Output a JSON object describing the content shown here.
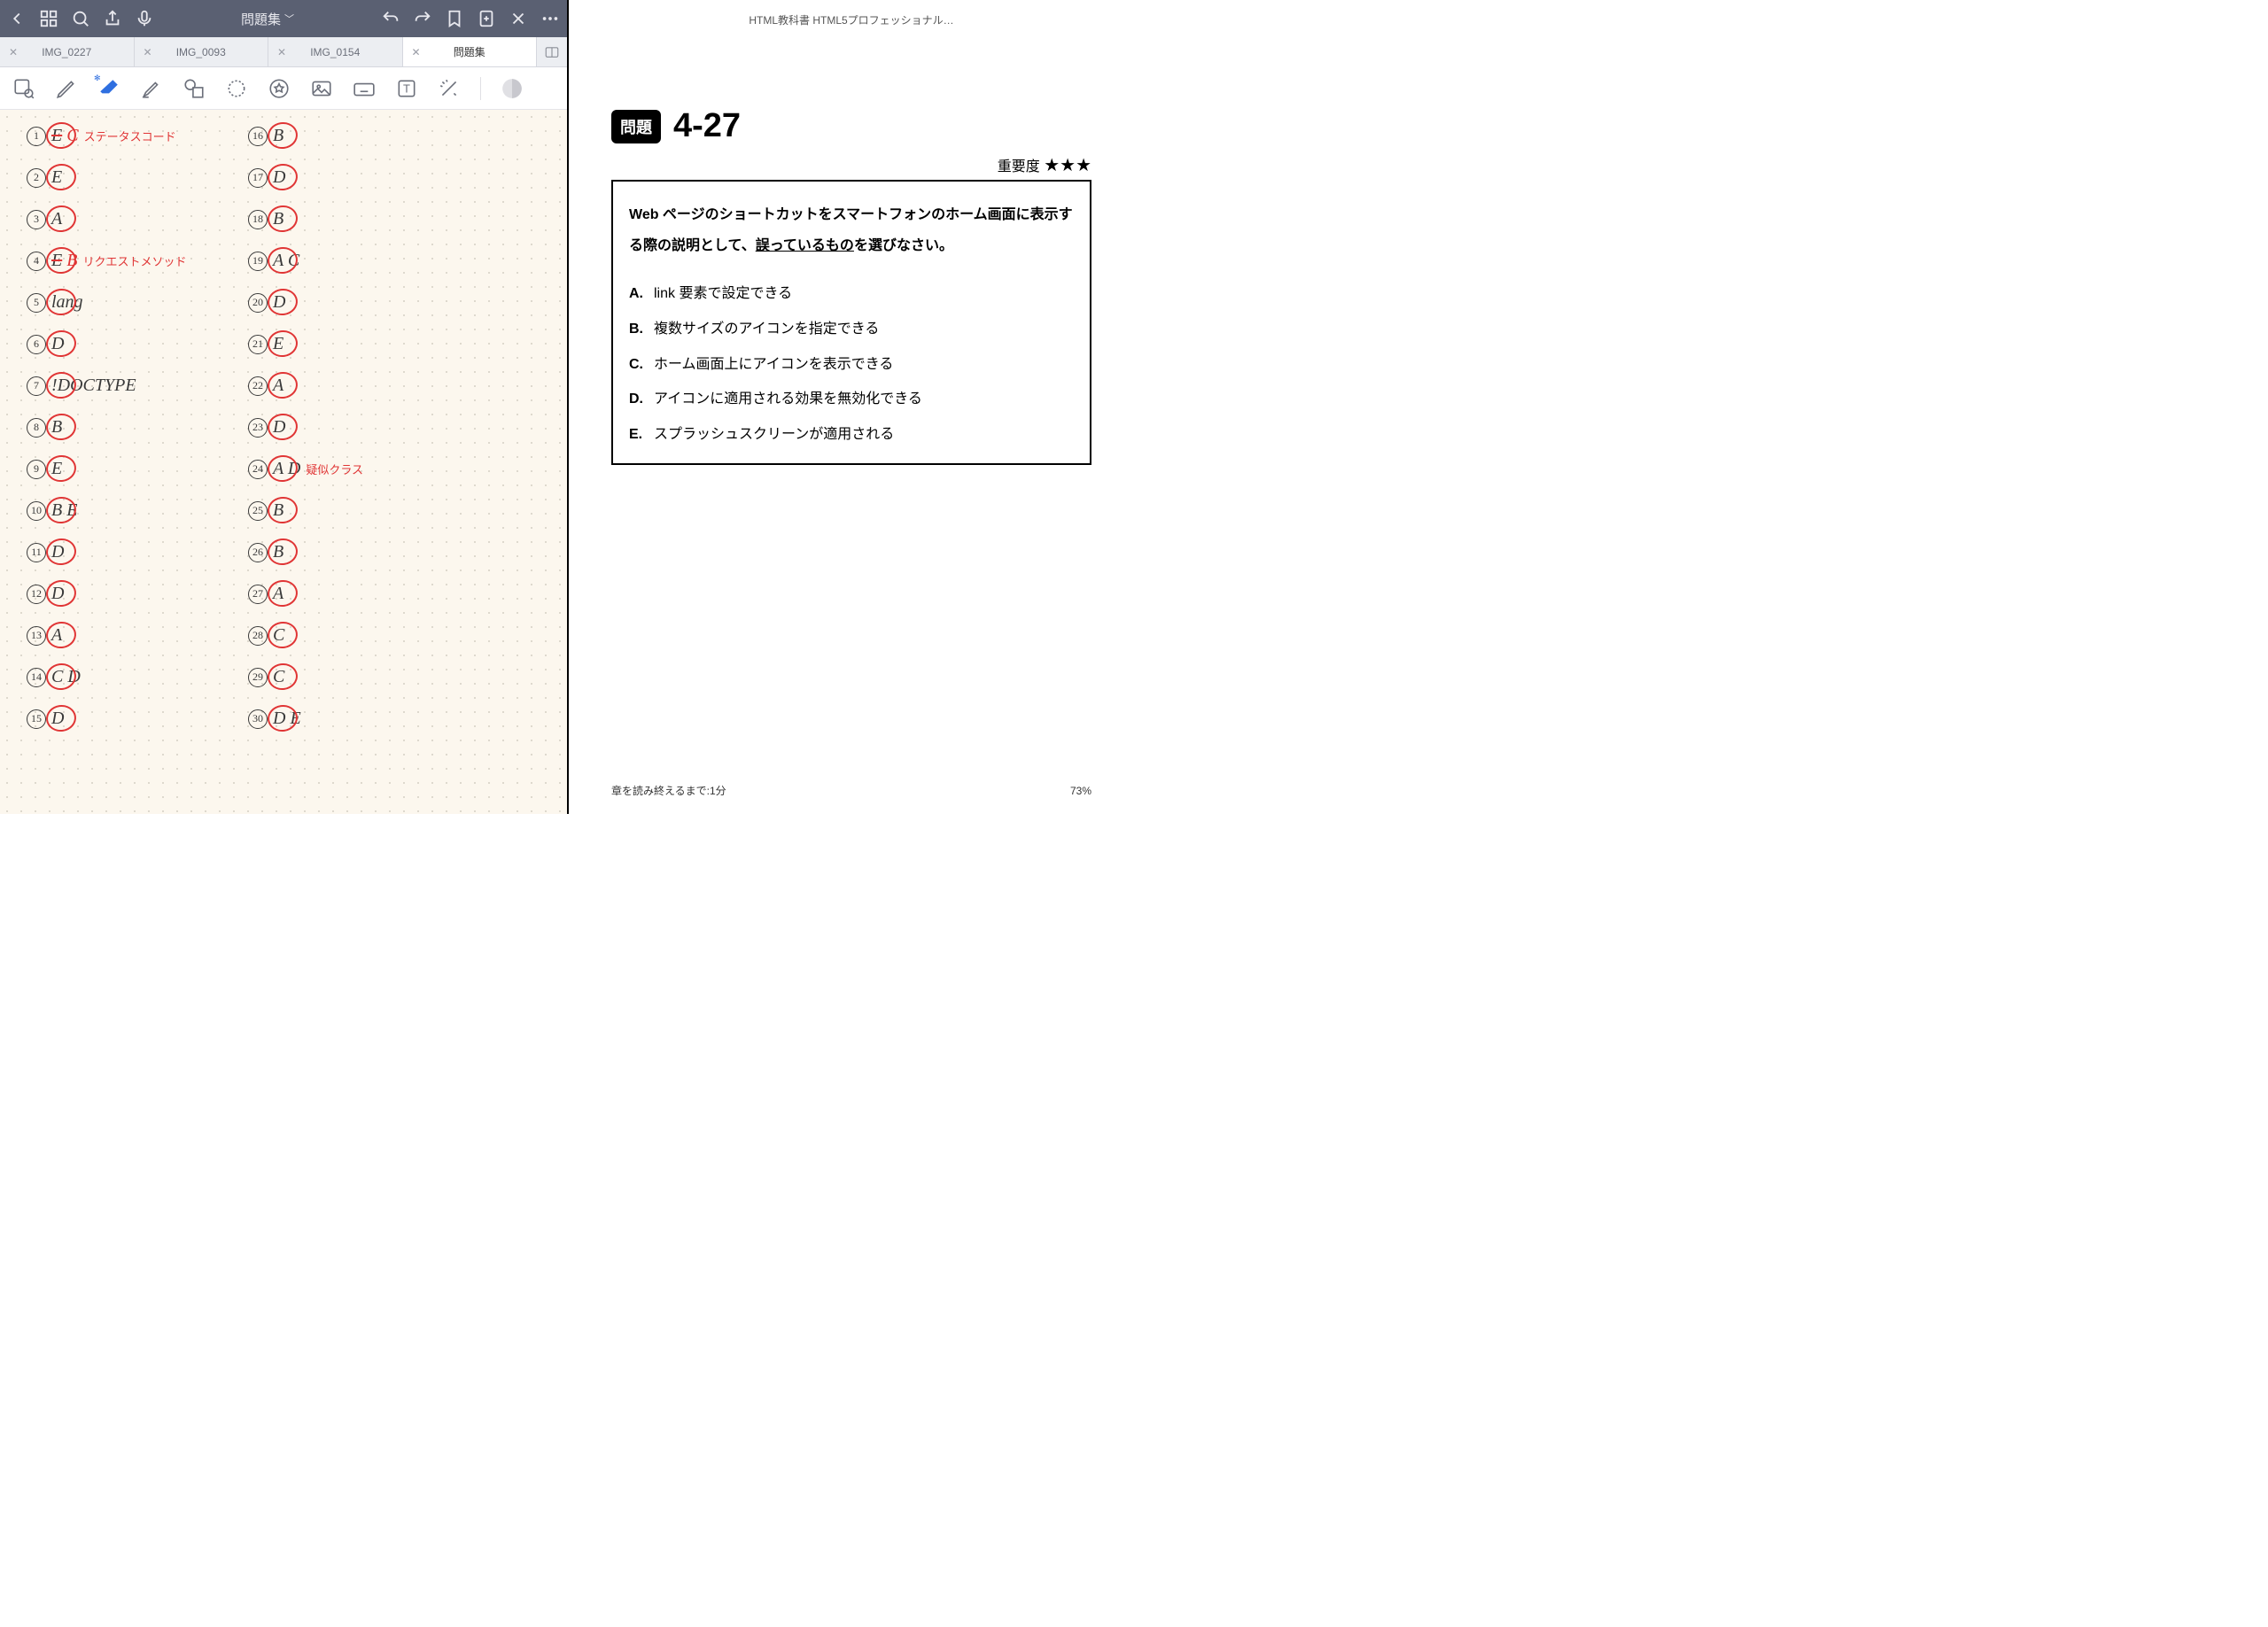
{
  "toolbar": {
    "title": "問題集"
  },
  "tabs": [
    {
      "label": "IMG_0227",
      "active": false
    },
    {
      "label": "IMG_0093",
      "active": false
    },
    {
      "label": "IMG_0154",
      "active": false
    },
    {
      "label": "問題集",
      "active": true
    }
  ],
  "answers_col1": [
    {
      "n": "1",
      "a": "E C",
      "note": "ステータスコード",
      "strike": true
    },
    {
      "n": "2",
      "a": "E",
      "note": ""
    },
    {
      "n": "3",
      "a": "A",
      "note": ""
    },
    {
      "n": "4",
      "a": "E B",
      "note": "リクエストメソッド",
      "strike": true
    },
    {
      "n": "5",
      "a": "lang",
      "note": ""
    },
    {
      "n": "6",
      "a": "D",
      "note": ""
    },
    {
      "n": "7",
      "a": "!DOCTYPE",
      "note": ""
    },
    {
      "n": "8",
      "a": "B",
      "note": ""
    },
    {
      "n": "9",
      "a": "E",
      "note": ""
    },
    {
      "n": "10",
      "a": "B E",
      "note": ""
    },
    {
      "n": "11",
      "a": "D",
      "note": ""
    },
    {
      "n": "12",
      "a": "D",
      "note": ""
    },
    {
      "n": "13",
      "a": "A",
      "note": ""
    },
    {
      "n": "14",
      "a": "C D",
      "note": ""
    },
    {
      "n": "15",
      "a": "D",
      "note": ""
    }
  ],
  "answers_col2": [
    {
      "n": "16",
      "a": "B",
      "note": ""
    },
    {
      "n": "17",
      "a": "D",
      "note": ""
    },
    {
      "n": "18",
      "a": "B",
      "note": ""
    },
    {
      "n": "19",
      "a": "A C",
      "note": ""
    },
    {
      "n": "20",
      "a": "D",
      "note": ""
    },
    {
      "n": "21",
      "a": "E",
      "note": ""
    },
    {
      "n": "22",
      "a": "A",
      "note": ""
    },
    {
      "n": "23",
      "a": "D",
      "note": ""
    },
    {
      "n": "24",
      "a": "A D",
      "note": "疑似クラス"
    },
    {
      "n": "25",
      "a": "B",
      "note": ""
    },
    {
      "n": "26",
      "a": "B",
      "note": ""
    },
    {
      "n": "27",
      "a": "A",
      "note": ""
    },
    {
      "n": "28",
      "a": "C",
      "note": ""
    },
    {
      "n": "29",
      "a": "C",
      "note": ""
    },
    {
      "n": "30",
      "a": "D E",
      "note": ""
    }
  ],
  "book": {
    "title": "HTML教科書 HTML5プロフェッショナル…",
    "badge": "問題",
    "number": "4-27",
    "importance_label": "重要度",
    "stars": "★★★",
    "question_pre": "Web ページのショートカットをスマートフォンのホーム画面に表示する際の説明として、",
    "question_underline": "誤っているもの",
    "question_post": "を選びなさい。",
    "choices": [
      {
        "label": "A.",
        "text": "link 要素で設定できる"
      },
      {
        "label": "B.",
        "text": "複数サイズのアイコンを指定できる"
      },
      {
        "label": "C.",
        "text": "ホーム画面上にアイコンを表示できる"
      },
      {
        "label": "D.",
        "text": "アイコンに適用される効果を無効化できる"
      },
      {
        "label": "E.",
        "text": "スプラッシュスクリーンが適用される"
      }
    ],
    "footer_left": "章を読み終えるまで:1分",
    "footer_right": "73%"
  }
}
